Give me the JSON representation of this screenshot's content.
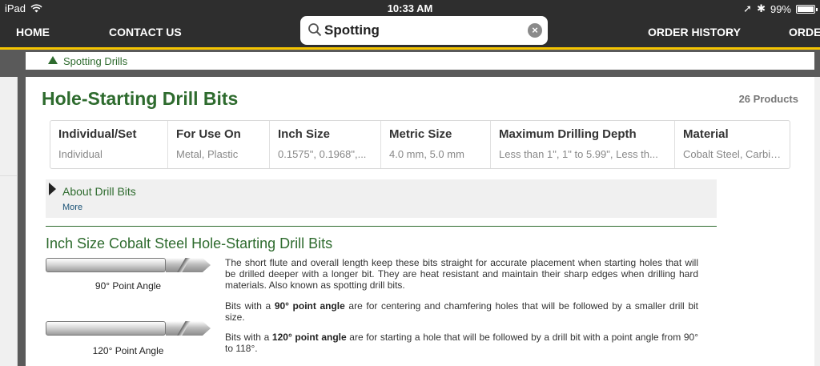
{
  "status_bar": {
    "device": "iPad",
    "time": "10:33 AM",
    "battery": "99%"
  },
  "nav": {
    "home": "HOME",
    "contact": "CONTACT US",
    "order_history": "ORDER HISTORY",
    "order_partial": "ORDER"
  },
  "search": {
    "value": "Spotting"
  },
  "breadcrumb": {
    "label": "Spotting Drills"
  },
  "product": {
    "title": "Hole-Starting Drill Bits",
    "count": "26 Products"
  },
  "filters": [
    {
      "label": "Individual/Set",
      "value": "Individual"
    },
    {
      "label": "For Use On",
      "value": "Metal, Plastic"
    },
    {
      "label": "Inch Size",
      "value": "0.1575\", 0.1968\",..."
    },
    {
      "label": "Metric Size",
      "value": "4.0 mm, 5.0 mm"
    },
    {
      "label": "Maximum Drilling Depth",
      "value": "Less than 1\", 1\" to 5.99\", Less th..."
    },
    {
      "label": "Material",
      "value": "Cobalt Steel, Carbide"
    }
  ],
  "about": {
    "title": "About Drill Bits",
    "more": "More"
  },
  "section": {
    "title": "Inch Size Cobalt Steel Hole-Starting Drill Bits",
    "bit_1_label": "90° Point Angle",
    "bit_2_label": "120° Point Angle",
    "para_1": "The short flute and overall length keep these bits straight for accurate placement when starting holes that will be drilled deeper with a longer bit. They are heat resistant and maintain their sharp edges when drilling hard materials. Also known as spotting drill bits.",
    "para_2_prefix": "Bits with a ",
    "para_2_bold": "90° point angle",
    "para_2_suffix": " are for centering and chamfering holes that will be followed by a smaller drill bit size.",
    "para_3_prefix": "Bits with a ",
    "para_3_bold": "120° point angle",
    "para_3_suffix": " are for starting a hole that will be followed by a drill bit with a point angle from 90° to 118°."
  },
  "colors": {
    "accent_green": "#2e6b2e",
    "nav_bg": "#2e2e2e",
    "nav_underline": "#f5c400"
  }
}
